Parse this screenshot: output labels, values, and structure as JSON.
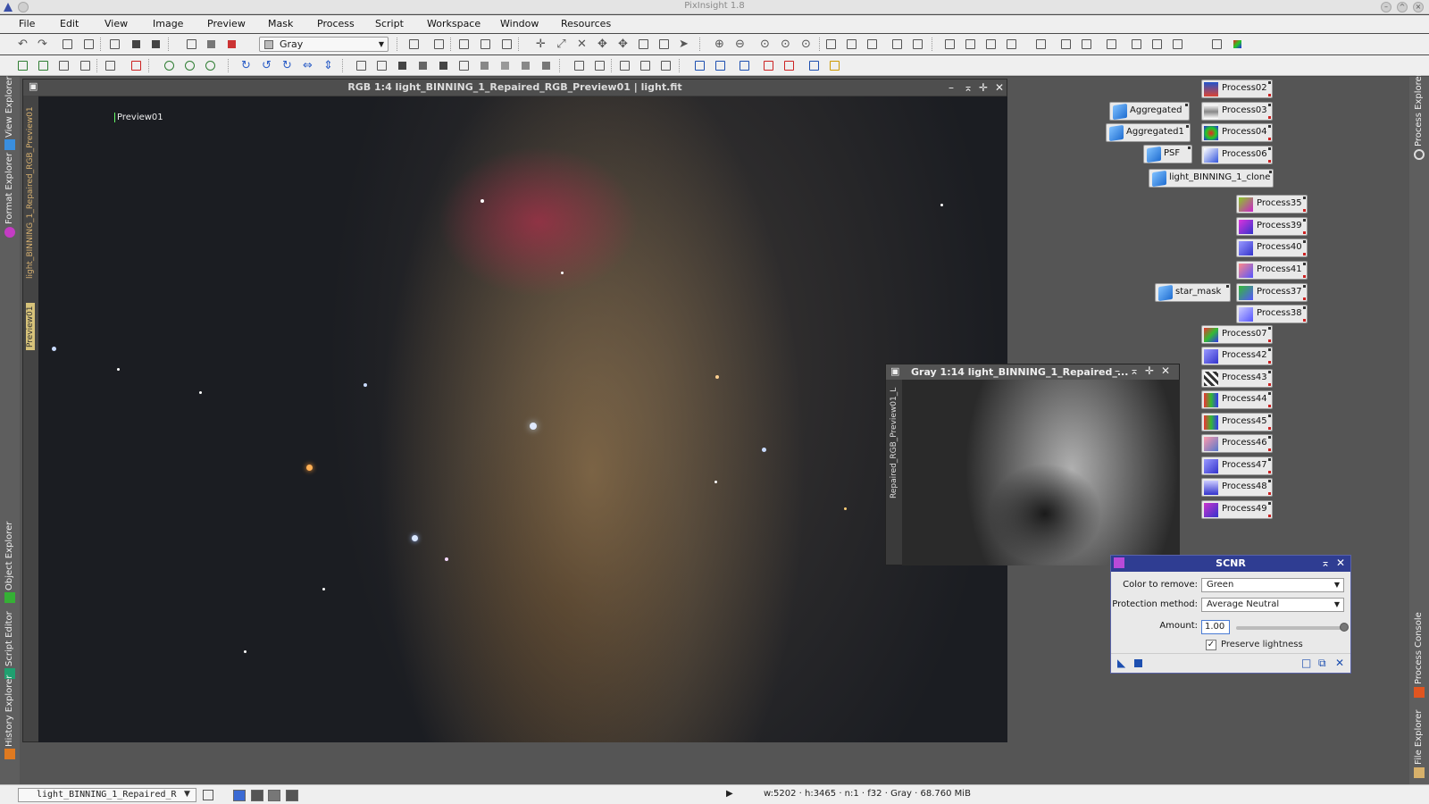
{
  "app": {
    "title": "PixInsight 1.8"
  },
  "menu": [
    "File",
    "Edit",
    "View",
    "Image",
    "Preview",
    "Mask",
    "Process",
    "Script",
    "Workspace",
    "Window",
    "Resources"
  ],
  "toolbar": {
    "channel_select": "Gray"
  },
  "left_panels": [
    "View Explorer",
    "Format Explorer",
    "Object Explorer",
    "Script Editor",
    "History Explorer"
  ],
  "right_panels": [
    "Process Explorer",
    "Process Console",
    "File Explorer"
  ],
  "main_window": {
    "title": "RGB 1:4 light_BINNING_1_Repaired_RGB_Preview01 | light.fit",
    "tabs": [
      "light_BINNING_1_Repaired_RGB_Preview01",
      "Preview01"
    ],
    "preview_label": "Preview01"
  },
  "gray_window": {
    "title": "Gray 1:14 light_BINNING_1_Repaired_...",
    "tab": "Repaired_RGB_Preview01_L"
  },
  "icons": [
    {
      "label": "Process02"
    },
    {
      "label": "Aggregated"
    },
    {
      "label": "Process03"
    },
    {
      "label": "Aggregated1"
    },
    {
      "label": "Process04"
    },
    {
      "label": "PSF"
    },
    {
      "label": "Process06"
    },
    {
      "label": "light_BINNING_1_clone"
    },
    {
      "label": "Process35"
    },
    {
      "label": "Process39"
    },
    {
      "label": "Process40"
    },
    {
      "label": "Process41"
    },
    {
      "label": "star_mask"
    },
    {
      "label": "Process37"
    },
    {
      "label": "Process38"
    },
    {
      "label": "Process07"
    },
    {
      "label": "Process42"
    },
    {
      "label": "Process43"
    },
    {
      "label": "Process44"
    },
    {
      "label": "Process45"
    },
    {
      "label": "Process46"
    },
    {
      "label": "Process47"
    },
    {
      "label": "Process48"
    },
    {
      "label": "Process49"
    }
  ],
  "scnr": {
    "title": "SCNR",
    "color_label": "Color to remove:",
    "color_value": "Green",
    "protection_label": "Protection method:",
    "protection_value": "Average Neutral",
    "amount_label": "Amount:",
    "amount_value": "1.00",
    "preserve_label": "Preserve lightness",
    "preserve_checked": true
  },
  "status": {
    "view": "light_BINNING_1_Repaired_R",
    "info": "w:5202 · h:3465 · n:1 · f32 · Gray · 68.760 MiB"
  }
}
